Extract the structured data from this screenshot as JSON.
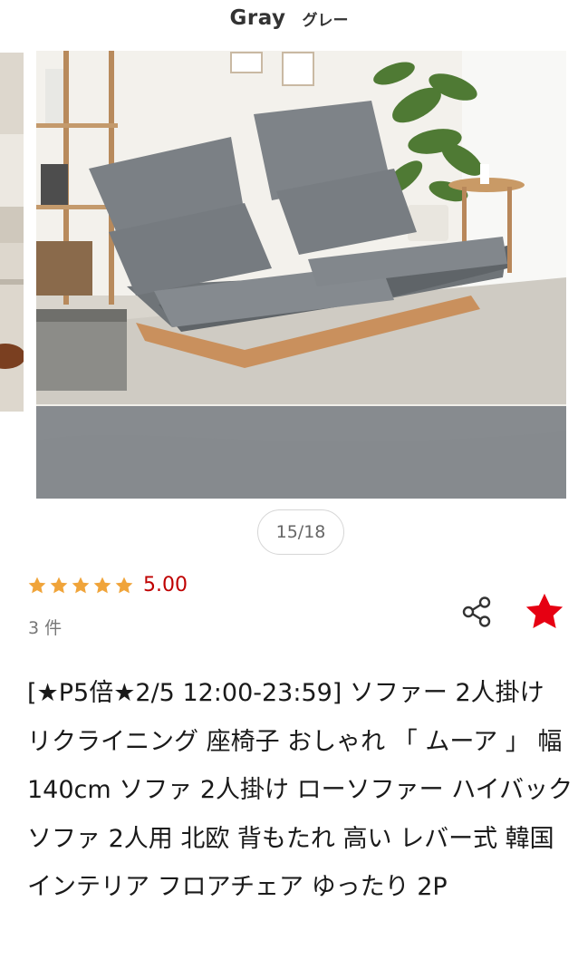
{
  "gallery": {
    "color_name_en": "Gray",
    "color_name_ja": "グレー",
    "counter": "15/18"
  },
  "rating": {
    "value": "5.00",
    "stars": 5,
    "review_count": "3 件"
  },
  "actions": {
    "share_icon": "share-icon",
    "favorite_icon": "star-filled-icon",
    "favorite_color": "#e60012"
  },
  "colors": {
    "accent_red": "#bf0000",
    "star_gold": "#f0a43a"
  },
  "product": {
    "title": "[★P5倍★2/5 12:00-23:59] ソファー 2人掛け リクライニング 座椅子 おしゃれ 「 ムーア 」 幅140cm ソファ 2人掛け ローソファー ハイバック ソファ 2人用 北欧 背もたれ 高い レバー式 韓国インテリア フロアチェア ゆったり 2P"
  }
}
